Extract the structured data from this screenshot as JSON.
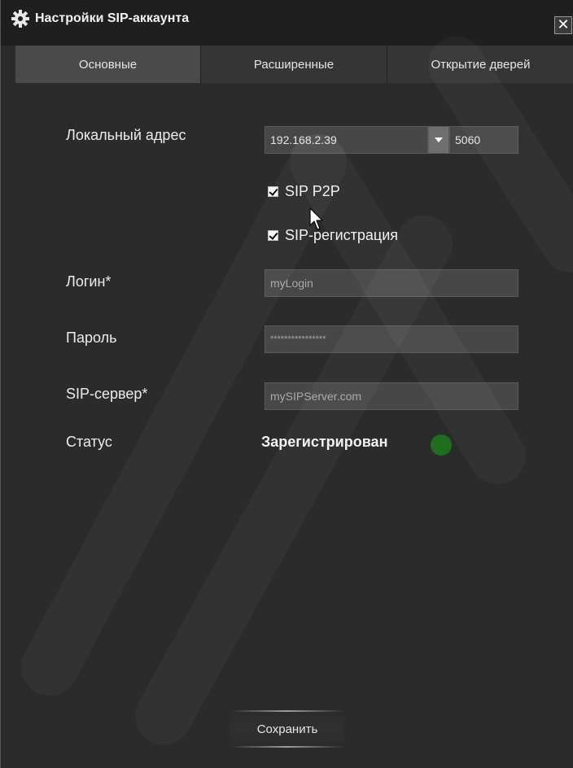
{
  "window": {
    "title": "Настройки SIP-аккаунта",
    "close_label": "✕"
  },
  "tabs": [
    {
      "label": "Основные",
      "active": true
    },
    {
      "label": "Расширенные",
      "active": false
    },
    {
      "label": "Открытие дверей",
      "active": false
    }
  ],
  "form": {
    "local_address_label": "Локальный адрес",
    "local_address_value": "192.168.2.39",
    "port_value": "5060",
    "sip_p2p_label": "SIP P2P",
    "sip_p2p_checked": true,
    "sip_registration_label": "SIP-регистрация",
    "sip_registration_checked": true,
    "login_label": "Логин*",
    "login_value": "myLogin",
    "password_label": "Пароль",
    "password_value": "****************",
    "server_label": "SIP-сервер*",
    "server_value": "mySIPServer.com",
    "status_label": "Статус",
    "status_value": "Зарегистрирован",
    "status_color": "#1e6e1e"
  },
  "actions": {
    "save_label": "Сохранить"
  }
}
